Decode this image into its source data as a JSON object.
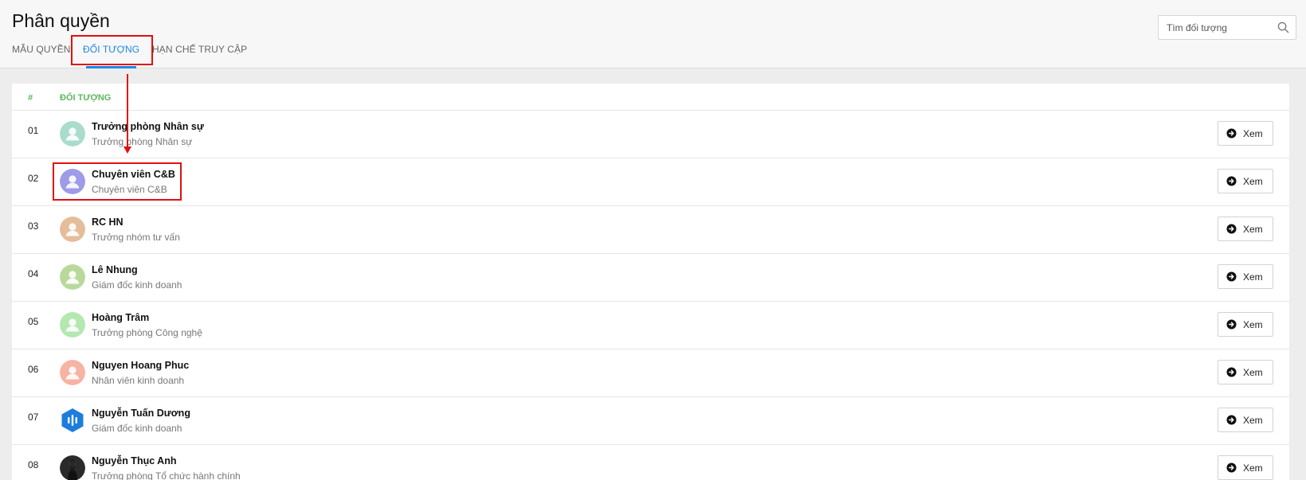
{
  "page": {
    "title": "Phân quyền"
  },
  "tabs": [
    {
      "label": "MẪU QUYỀN",
      "active": false
    },
    {
      "label": "ĐỐI TƯỢNG",
      "active": true
    },
    {
      "label": "HẠN CHẾ TRUY CẬP",
      "active": false
    }
  ],
  "search": {
    "placeholder": "Tìm đối tượng",
    "value": "",
    "icon": "search-icon"
  },
  "table": {
    "headers": {
      "index": "#",
      "object": "ĐỐI TƯỢNG"
    },
    "view_label": "Xem",
    "view_icon": "arrow-circle-right-icon",
    "rows": [
      {
        "index": "01",
        "name": "Trưởng phòng Nhân sự",
        "subtitle": "Trưởng phòng Nhân sự",
        "avatar_color": "#a9dccc",
        "avatar": "person-icon"
      },
      {
        "index": "02",
        "name": "Chuyên viên C&B",
        "subtitle": "Chuyên viên C&B",
        "avatar_color": "#9e9be8",
        "avatar": "person-icon"
      },
      {
        "index": "03",
        "name": "RC HN",
        "subtitle": "Trưởng nhóm tư vấn",
        "avatar_color": "#e5bd9b",
        "avatar": "person-icon"
      },
      {
        "index": "04",
        "name": "Lê Nhung",
        "subtitle": "Giám đốc kinh doanh",
        "avatar_color": "#b8d99b",
        "avatar": "person-icon"
      },
      {
        "index": "05",
        "name": "Hoàng Trâm",
        "subtitle": "Trưởng phòng Công nghệ",
        "avatar_color": "#b3e8b0",
        "avatar": "person-icon"
      },
      {
        "index": "06",
        "name": "Nguyen Hoang Phuc",
        "subtitle": "Nhân viên kinh doanh",
        "avatar_color": "#f7b3a3",
        "avatar": "person-icon"
      },
      {
        "index": "07",
        "name": "Nguyễn Tuấn Dương",
        "subtitle": "Giám đốc kinh doanh",
        "avatar_color": "#1e7ddb",
        "avatar": "logo-icon"
      },
      {
        "index": "08",
        "name": "Nguyễn Thục Anh",
        "subtitle": "Trưởng phòng Tổ chức hành chính",
        "avatar_color": "#2a2a2a",
        "avatar": "photo-icon"
      }
    ]
  },
  "colors": {
    "accent": "#1e88e5",
    "header_green": "#5cb85c",
    "annotation": "#e01010"
  }
}
